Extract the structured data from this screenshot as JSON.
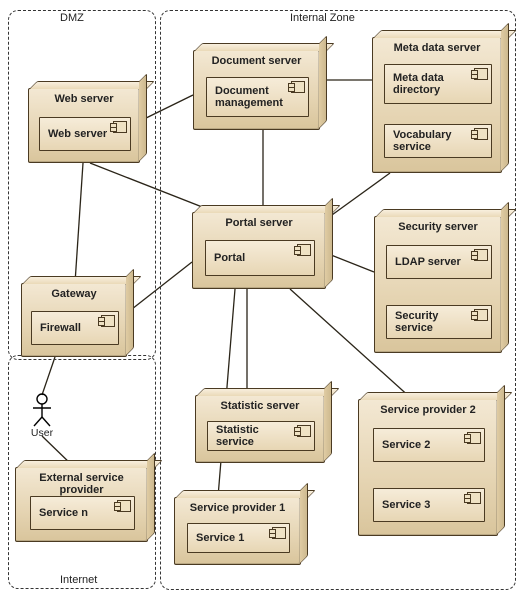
{
  "zones": {
    "dmz": {
      "label": "DMZ"
    },
    "internal": {
      "label": "Internal Zone"
    },
    "internet": {
      "label": "Internet"
    }
  },
  "actor": {
    "label": "User"
  },
  "nodes": {
    "webServer": {
      "title": "Web server",
      "components": {
        "c0": "Web server"
      }
    },
    "gateway": {
      "title": "Gateway",
      "components": {
        "c0": "Firewall"
      }
    },
    "extServiceProv": {
      "title": "External service provider",
      "components": {
        "c0": "Service n"
      }
    },
    "documentServer": {
      "title": "Document server",
      "components": {
        "c0": "Document\nmanagement"
      }
    },
    "portalServer": {
      "title": "Portal server",
      "components": {
        "c0": "Portal"
      }
    },
    "statisticServer": {
      "title": "Statistic server",
      "components": {
        "c0": "Statistic service"
      }
    },
    "serviceProvider1": {
      "title": "Service provider 1",
      "components": {
        "c0": "Service 1"
      }
    },
    "metaDataServer": {
      "title": "Meta data server",
      "components": {
        "c0": "Meta data directory",
        "c1": "Vocabulary service"
      }
    },
    "securityServer": {
      "title": "Security server",
      "components": {
        "c0": "LDAP server",
        "c1": "Security service"
      }
    },
    "serviceProvider2": {
      "title": "Service provider 2",
      "components": {
        "c0": "Service 2",
        "c1": "Service 3"
      }
    }
  },
  "associations": [
    [
      "webServer",
      "documentServer"
    ],
    [
      "webServer",
      "portalServer"
    ],
    [
      "webServer",
      "gateway"
    ],
    [
      "gateway",
      "portalServer"
    ],
    [
      "gateway",
      "actor:user"
    ],
    [
      "actor:user",
      "extServiceProv"
    ],
    [
      "documentServer",
      "metaDataServer"
    ],
    [
      "portalServer",
      "documentServer"
    ],
    [
      "portalServer",
      "metaDataServer"
    ],
    [
      "portalServer",
      "securityServer"
    ],
    [
      "portalServer",
      "statisticServer"
    ],
    [
      "portalServer",
      "serviceProvider1"
    ],
    [
      "portalServer",
      "serviceProvider2"
    ]
  ]
}
